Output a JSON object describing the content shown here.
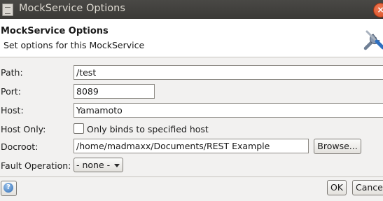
{
  "window": {
    "title": "MockService Options",
    "close_glyph": "×"
  },
  "header": {
    "title": "MockService Options",
    "description": "Set options for this MockService"
  },
  "form": {
    "path": {
      "label": "Path:",
      "value": "/test"
    },
    "port": {
      "label": "Port:",
      "value": "8089"
    },
    "host": {
      "label": "Host:",
      "value": "Yamamoto"
    },
    "host_only": {
      "label": "Host Only:",
      "checkbox_label": "Only binds to specified host",
      "checked": false
    },
    "docroot": {
      "label": "Docroot:",
      "value": "/home/madmaxx/Documents/REST Example",
      "browse_label": "Browse..."
    },
    "fault_operation": {
      "label": "Fault Operation:",
      "selected": "- none -"
    }
  },
  "footer": {
    "help_glyph": "?",
    "ok_label": "OK",
    "cancel_label": "Cancel"
  },
  "icons": {
    "window": "window-icon",
    "close": "close-icon",
    "tools": "tools-icon",
    "help": "help-icon",
    "dropdown": "chevron-down-icon"
  },
  "colors": {
    "titlebar": "#3b3a37",
    "close_button": "#e0562a",
    "dialog_bg": "#f2f1f0",
    "header_bg": "#ffffff"
  }
}
